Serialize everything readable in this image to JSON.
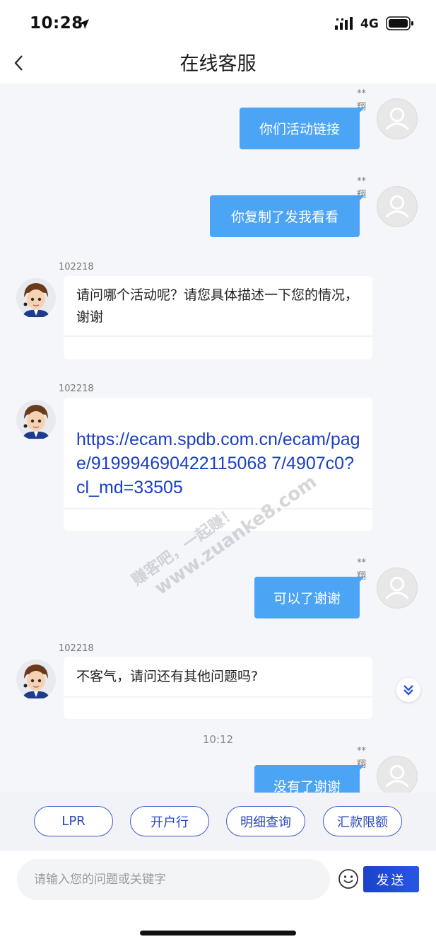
{
  "status_bar": {
    "time": "10:28",
    "network": "4G"
  },
  "header": {
    "title": "在线客服"
  },
  "messages": [
    {
      "type": "user",
      "sender": "**翔",
      "text": "你们活动链接"
    },
    {
      "type": "user",
      "sender": "**翔",
      "text": "你复制了发我看看"
    },
    {
      "type": "agent",
      "sender": "102218",
      "text": "请问哪个活动呢？请您具体描述一下您的情况，谢谢"
    },
    {
      "type": "agent",
      "sender": "102218",
      "text": "https://ecam.spdb.com.cn/ecam/page/919994690422115068 7/4907c0?cl_md=33505"
    },
    {
      "type": "user",
      "sender": "**翔",
      "text": "可以了谢谢"
    },
    {
      "type": "agent",
      "sender": "102218",
      "text": "不客气，请问还有其他问题吗?"
    },
    {
      "type": "time",
      "text": "10:12"
    },
    {
      "type": "user",
      "sender": "**翔",
      "text": "没有了谢谢"
    }
  ],
  "watermark": {
    "line1": "赚客吧，一起赚！",
    "line2": "www.zuanke8.com"
  },
  "quick_replies": [
    "LPR",
    "开户行",
    "明细查询",
    "汇款限额"
  ],
  "input": {
    "placeholder": "请输入您的问题或关键字",
    "value": ""
  },
  "send_label": "发送",
  "colors": {
    "user_bubble": "#4ba4f4",
    "send_button": "#1b43c8",
    "link": "#1a3fc4",
    "chip_border": "#3a5bd4"
  }
}
